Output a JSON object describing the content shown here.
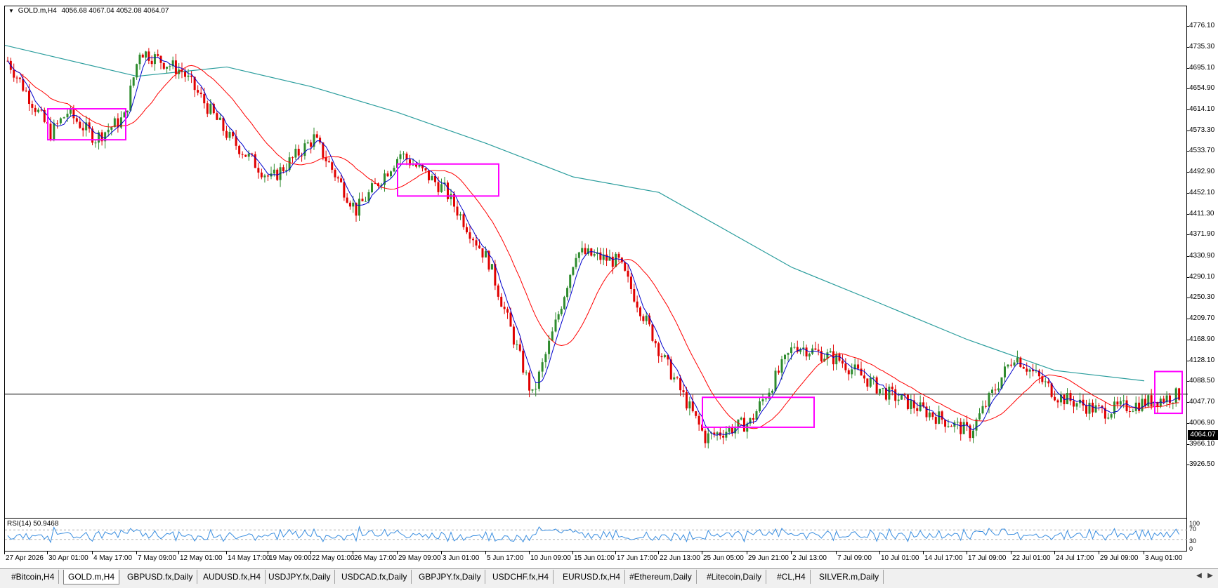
{
  "chart_title": {
    "symbol": "GOLD.m,H4",
    "ohlc": "4056.68 4067.04 4052.08 4064.07"
  },
  "rsi_label": "RSI(14) 50.9468",
  "price_axis": [
    "4776.10",
    "4735.30",
    "4695.10",
    "4654.90",
    "4614.10",
    "4573.30",
    "4533.70",
    "4492.90",
    "4452.10",
    "4411.30",
    "4371.90",
    "4330.90",
    "4290.10",
    "4250.30",
    "4209.70",
    "4168.90",
    "4128.10",
    "4088.50",
    "4047.70",
    "4006.90",
    "3966.10",
    "3926.50"
  ],
  "current_price": "4064.07",
  "rsi_axis": [
    "100",
    "70",
    "30",
    "0"
  ],
  "time_axis": [
    "27 Apr 2026",
    "30 Apr 01:00",
    "4 May 17:00",
    "7 May 09:00",
    "12 May 01:00",
    "14 May 17:00",
    "19 May 09:00",
    "22 May 01:00",
    "26 May 17:00",
    "29 May 09:00",
    "3 Jun 01:00",
    "5 Jun 17:00",
    "10 Jun 09:00",
    "15 Jun 01:00",
    "17 Jun 17:00",
    "22 Jun 13:00",
    "25 Jun 05:00",
    "29 Jun 21:00",
    "2 Jul 13:00",
    "7 Jul 09:00",
    "10 Jul 01:00",
    "14 Jul 17:00",
    "17 Jul 09:00",
    "22 Jul 01:00",
    "24 Jul 17:00",
    "29 Jul 09:00",
    "3 Aug 01:00"
  ],
  "tabs": [
    {
      "label": "#Bitcoin,H4",
      "active": false
    },
    {
      "label": "GOLD.m,H4",
      "active": true
    },
    {
      "label": "GBPUSD.fx,Daily",
      "active": false
    },
    {
      "label": "AUDUSD.fx,H4",
      "active": false
    },
    {
      "label": "USDJPY.fx,Daily",
      "active": false
    },
    {
      "label": "USDCAD.fx,Daily",
      "active": false
    },
    {
      "label": "GBPJPY.fx,Daily",
      "active": false
    },
    {
      "label": "USDCHF.fx,H4",
      "active": false
    },
    {
      "label": "EURUSD.fx,H4",
      "active": false
    },
    {
      "label": "#Ethereum,Daily",
      "active": false
    },
    {
      "label": "#Litecoin,Daily",
      "active": false
    },
    {
      "label": "#CL,H4",
      "active": false
    },
    {
      "label": "SILVER.m,Daily",
      "active": false
    }
  ],
  "colors": {
    "bull": "#2e8b2e",
    "bear": "#e00000",
    "ma_fast": "#0000cc",
    "ma_mid": "#ff0000",
    "ma_slow": "#2a9d9d",
    "highlight": "#ff00ff",
    "rsi": "#3a8ee0"
  },
  "chart_data": {
    "type": "candlestick",
    "symbol": "GOLD.m",
    "timeframe": "H4",
    "ylim": [
      3926.5,
      4786
    ],
    "close_path": [
      {
        "date": "27 Apr 2026",
        "value": 4710
      },
      {
        "date": "30 Apr 01:00",
        "value": 4570
      },
      {
        "date": "1 May",
        "value": 4610
      },
      {
        "date": "4 May 17:00",
        "value": 4560
      },
      {
        "date": "6 May",
        "value": 4600
      },
      {
        "date": "7 May 09:00",
        "value": 4730
      },
      {
        "date": "12 May 01:00",
        "value": 4690
      },
      {
        "date": "14 May 17:00",
        "value": 4560
      },
      {
        "date": "19 May 09:00",
        "value": 4480
      },
      {
        "date": "22 May 01:00",
        "value": 4560
      },
      {
        "date": "26 May 17:00",
        "value": 4420
      },
      {
        "date": "29 May 09:00",
        "value": 4530
      },
      {
        "date": "3 Jun 01:00",
        "value": 4460
      },
      {
        "date": "5 Jun 17:00",
        "value": 4320
      },
      {
        "date": "10 Jun 09:00",
        "value": 4060
      },
      {
        "date": "12 Jun",
        "value": 4200
      },
      {
        "date": "15 Jun 01:00",
        "value": 4340
      },
      {
        "date": "17 Jun 17:00",
        "value": 4320
      },
      {
        "date": "22 Jun 13:00",
        "value": 4140
      },
      {
        "date": "25 Jun 05:00",
        "value": 3980
      },
      {
        "date": "29 Jun 21:00",
        "value": 4010
      },
      {
        "date": "2 Jul 13:00",
        "value": 4160
      },
      {
        "date": "7 Jul 09:00",
        "value": 4130
      },
      {
        "date": "10 Jul 01:00",
        "value": 4070
      },
      {
        "date": "14 Jul 17:00",
        "value": 4030
      },
      {
        "date": "17 Jul 09:00",
        "value": 3990
      },
      {
        "date": "22 Jul 01:00",
        "value": 4140
      },
      {
        "date": "24 Jul 17:00",
        "value": 4060
      },
      {
        "date": "29 Jul 09:00",
        "value": 4030
      },
      {
        "date": "3 Aug 01:00",
        "value": 4064.07
      }
    ],
    "ma_slow_path": [
      {
        "date": "27 Apr 2026",
        "value": 4740
      },
      {
        "date": "7 May 09:00",
        "value": 4680
      },
      {
        "date": "14 May 17:00",
        "value": 4698
      },
      {
        "date": "22 May 01:00",
        "value": 4660
      },
      {
        "date": "29 May 09:00",
        "value": 4610
      },
      {
        "date": "5 Jun 17:00",
        "value": 4550
      },
      {
        "date": "15 Jun 01:00",
        "value": 4485
      },
      {
        "date": "22 Jun 13:00",
        "value": 4455
      },
      {
        "date": "2 Jul 13:00",
        "value": 4310
      },
      {
        "date": "10 Jul 01:00",
        "value": 4240
      },
      {
        "date": "17 Jul 09:00",
        "value": 4170
      },
      {
        "date": "24 Jul 17:00",
        "value": 4110
      },
      {
        "date": "3 Aug 01:00",
        "value": 4090
      }
    ],
    "rsi_levels": [
      30,
      70
    ],
    "rsi_last": 50.9468,
    "horizontal_line": 4064.07,
    "highlight_boxes": [
      {
        "from": "30 Apr 01:00",
        "to": "5 May",
        "high": 4617,
        "low": 4557
      },
      {
        "from": "29 May 09:00",
        "to": "4 Jun",
        "high": 4510,
        "low": 4448
      },
      {
        "from": "25 Jun 05:00",
        "to": "1 Jul",
        "high": 4058,
        "low": 4000
      },
      {
        "from": "1 Aug",
        "to": "3 Aug 01:00",
        "high": 4108,
        "low": 4027
      }
    ]
  }
}
